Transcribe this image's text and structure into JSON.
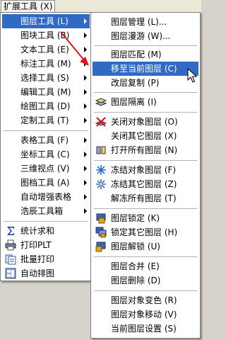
{
  "menubar": {
    "title": "扩展工具 (X)"
  },
  "main_menu": {
    "items": [
      {
        "label": "图层工具 (L)",
        "submenu": true,
        "highlighted": true
      },
      {
        "label": "图块工具 (B)",
        "submenu": true
      },
      {
        "label": "文本工具 (E)",
        "submenu": true
      },
      {
        "label": "标注工具 (M)",
        "submenu": true
      },
      {
        "label": "选择工具 (S)",
        "submenu": true
      },
      {
        "label": "编辑工具 (M)",
        "submenu": true
      },
      {
        "label": "绘图工具 (D)",
        "submenu": true
      },
      {
        "label": "定制工具 (T)",
        "submenu": true
      },
      {
        "label": "表格工具 (F)",
        "submenu": true
      },
      {
        "label": "坐标工具 (C)",
        "submenu": true
      },
      {
        "label": "三维视点 (V)",
        "submenu": true
      },
      {
        "label": "图档工具 (A)",
        "submenu": true
      },
      {
        "label": "自动增强表格",
        "submenu": true
      },
      {
        "label": "浩辰工具箱",
        "submenu": true
      },
      {
        "label": "统计求和",
        "icon": "sigma-icon"
      },
      {
        "label": "打印PLT",
        "icon": "printer-icon"
      },
      {
        "label": "批量打印",
        "icon": "batch-print-icon"
      },
      {
        "label": "自动排图",
        "icon": "auto-layout-icon"
      }
    ]
  },
  "layer_submenu": {
    "items": [
      {
        "label": "图层管理 (L)..."
      },
      {
        "label": "图层漫游 (W)..."
      },
      {
        "label": "图层匹配 (M)"
      },
      {
        "label": "移至当前图层 (C)",
        "highlighted": true
      },
      {
        "label": "改层复制 (P)"
      },
      {
        "label": "图层隔离 (I)",
        "icon": "layer-isolate-icon"
      },
      {
        "label": "关闭对象图层 (O)",
        "icon": "layer-off-icon"
      },
      {
        "label": "关闭其它图层 (X)"
      },
      {
        "label": "打开所有图层 (N)",
        "icon": "layer-on-icon"
      },
      {
        "label": "冻结对象图层 (F)",
        "icon": "layer-freeze-icon"
      },
      {
        "label": "冻结其它图层 (Z)",
        "icon": "layer-freeze-others-icon"
      },
      {
        "label": "解冻所有图层 (T)"
      },
      {
        "label": "图层锁定 (K)",
        "icon": "layer-lock-icon"
      },
      {
        "label": "锁定其它图层 (H)",
        "icon": "layer-lock-others-icon"
      },
      {
        "label": "图层解锁 (U)",
        "icon": "layer-unlock-icon"
      },
      {
        "label": "图层合并 (E)"
      },
      {
        "label": "图层删除 (D)"
      },
      {
        "label": "图层对象变色 (R)"
      },
      {
        "label": "图层对象移动 (V)"
      },
      {
        "label": "当前图层设置 (S)"
      }
    ]
  },
  "colors": {
    "highlight": "#316ac5",
    "annotation_arrow": "#e0141e"
  }
}
